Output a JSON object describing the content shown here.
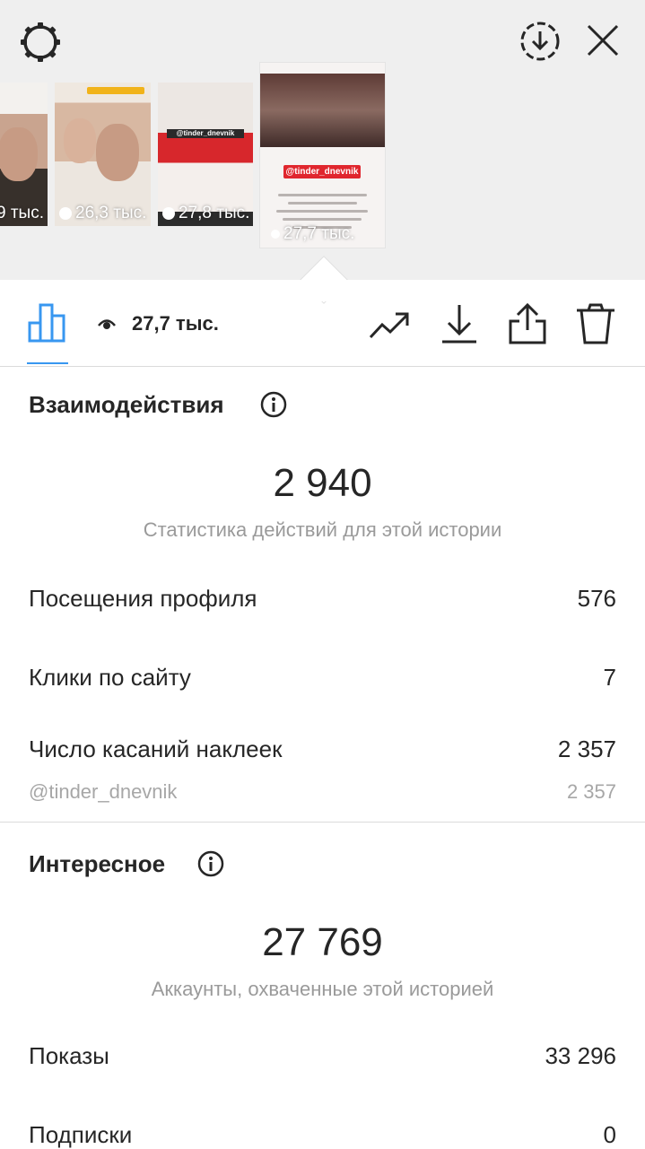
{
  "top": {
    "thumbnails": [
      {
        "views": "9 тыс."
      },
      {
        "views": "26,3 тыс."
      },
      {
        "views": "27,8 тыс."
      },
      {
        "views": "27,7 тыс.",
        "tag": "@tinder_dnevnik"
      }
    ],
    "thumb3_tag": "@tinder_dnevnik"
  },
  "toolbar": {
    "reach": "27,7 тыс."
  },
  "interactions": {
    "title": "Взаимодействия",
    "total": "2 940",
    "caption": "Статистика действий для этой истории",
    "rows": [
      {
        "label": "Посещения профиля",
        "value": "576"
      },
      {
        "label": "Клики по сайту",
        "value": "7"
      },
      {
        "label": "Число касаний наклеек",
        "value": "2 357"
      }
    ],
    "sub": {
      "label": "@tinder_dnevnik",
      "value": "2 357"
    }
  },
  "discovery": {
    "title": "Интересное",
    "total": "27 769",
    "caption": "Аккаунты, охваченные этой историей",
    "rows": [
      {
        "label": "Показы",
        "value": "33 296"
      },
      {
        "label": "Подписки",
        "value": "0"
      }
    ]
  },
  "colors": {
    "accent": "#3897f0",
    "tag_red": "#e0262e"
  }
}
